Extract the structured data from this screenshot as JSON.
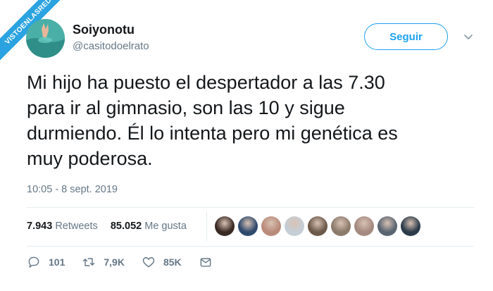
{
  "watermark": "VISTOENLASREDES",
  "user": {
    "display_name": "Soiyonotu",
    "handle": "@casitodoelrato"
  },
  "follow_label": "Seguir",
  "tweet": {
    "lines": [
      "Mi hijo ha puesto el despertador a las 7.30",
      "para ir al gimnasio, son las 10 y sigue",
      "durmiendo. Él lo intenta pero mi genética es",
      "muy poderosa."
    ],
    "timestamp": "10:05 - 8 sept. 2019"
  },
  "stats": {
    "retweets_count": "7.943",
    "retweets_label": "Retweets",
    "likes_count": "85.052",
    "likes_label": "Me gusta"
  },
  "likers": [
    {
      "name": "liker-1",
      "color": "#3a2a24"
    },
    {
      "name": "liker-2",
      "color": "#2f4a6d"
    },
    {
      "name": "liker-3",
      "color": "#b98b7a"
    },
    {
      "name": "liker-4",
      "color": "#c5ced6"
    },
    {
      "name": "liker-5",
      "color": "#6d5a4a"
    },
    {
      "name": "liker-6",
      "color": "#8c7a6a"
    },
    {
      "name": "liker-7",
      "color": "#a58a80"
    },
    {
      "name": "liker-8",
      "color": "#5a6572"
    },
    {
      "name": "liker-9",
      "color": "#2b3b4a"
    }
  ],
  "actions": {
    "replies": "101",
    "retweets": "7,9K",
    "likes": "85K"
  },
  "colors": {
    "accent": "#1da1f2",
    "secondary_text": "#657786",
    "watermark": "#2aa3e0"
  }
}
